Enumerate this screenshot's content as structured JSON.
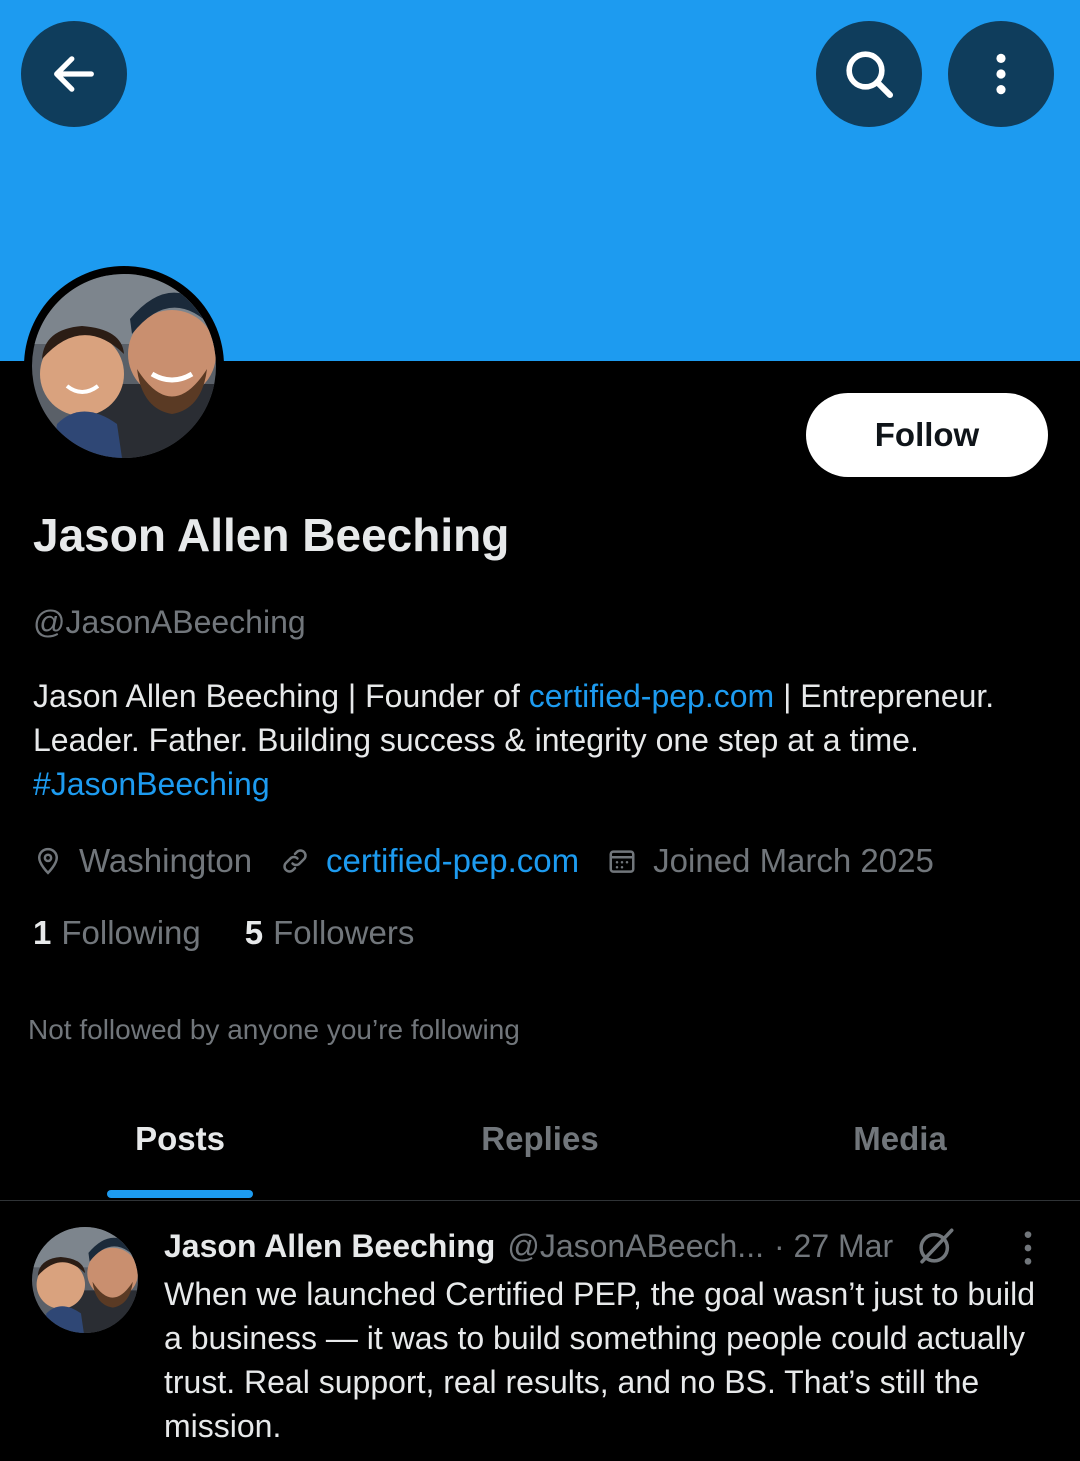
{
  "colors": {
    "banner": "#1d9bf0",
    "accent": "#1d9bf0",
    "background": "#000000",
    "muted_text": "#71767b",
    "primary_text": "#e7e9ea"
  },
  "header": {
    "back_icon": "arrow-left-icon",
    "search_icon": "search-icon",
    "more_icon": "more-vertical-icon"
  },
  "profile": {
    "name": "Jason Allen Beeching",
    "handle": "@JasonABeeching",
    "follow_label": "Follow",
    "bio": {
      "part1": "Jason Allen Beeching | Founder of ",
      "link1": "certified-pep.com",
      "part2": " | Entrepreneur. Leader. Father. Building success & integrity one step at a time. ",
      "hashtag": "#JasonBeeching"
    },
    "location": "Washington",
    "website": "certified-pep.com",
    "joined": "Joined March 2025",
    "following_count": "1",
    "following_label": "Following",
    "followers_count": "5",
    "followers_label": "Followers",
    "not_followed_text": "Not followed by anyone you’re following"
  },
  "tabs": [
    {
      "label": "Posts",
      "active": true
    },
    {
      "label": "Replies",
      "active": false
    },
    {
      "label": "Media",
      "active": false
    }
  ],
  "post": {
    "name": "Jason Allen Beeching",
    "handle": "@JasonABeech...",
    "date": "· 27 Mar",
    "grok_icon": "grok-icon",
    "text": "When we launched Certified PEP, the goal wasn’t just to build a business — it was to build something people could actually trust. Real support, real results, and no BS. That’s still the mission."
  }
}
